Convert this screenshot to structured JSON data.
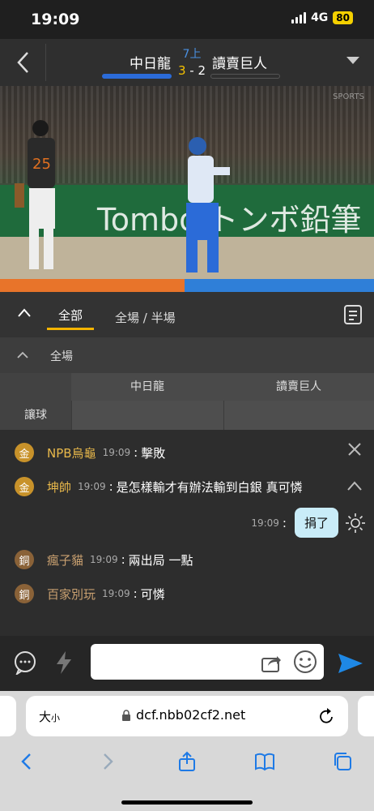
{
  "status": {
    "time": "19:09",
    "network": "4G",
    "battery": "80"
  },
  "header": {
    "home_team": "中日龍",
    "away_team": "讀賣巨人",
    "inning": "7上",
    "score_home": "3",
    "score_sep": "-",
    "score_away": "2"
  },
  "video": {
    "banner_text": "Tombo トンボ鉛筆",
    "player_number": "25",
    "watermark": "SPORTS"
  },
  "tabs": {
    "all": "全部",
    "half": "全場 / 半場"
  },
  "section": {
    "title": "全場"
  },
  "table": {
    "col1": "中日龍",
    "col2": "讀賣巨人",
    "row_label": "讓球"
  },
  "chat": {
    "messages": [
      {
        "badge": "金",
        "user": "NPB烏龜",
        "time": "19:09",
        "text": "擊敗"
      },
      {
        "badge": "金",
        "user": "坤帥",
        "time": "19:09",
        "text": "是怎樣輸才有辦法輸到白銀  真可憐"
      },
      {
        "badge": "銅",
        "user": "瘋子貓",
        "time": "19:09",
        "text": "兩出局  一點"
      },
      {
        "badge": "銅",
        "user": "百家別玩",
        "time": "19:09",
        "text": "可憐"
      }
    ],
    "mine": {
      "time": "19:09",
      "text": "捐了"
    }
  },
  "input": {
    "placeholder": ""
  },
  "browser": {
    "text_size_big": "大",
    "text_size_small": "小",
    "url": "dcf.nbb02cf2.net"
  },
  "colors": {
    "accent": "#f4b400",
    "home_bar": "#2b6bd8",
    "send": "#1e88e5",
    "gold_badge": "#c8922a",
    "bronze_badge": "#8a6238"
  }
}
